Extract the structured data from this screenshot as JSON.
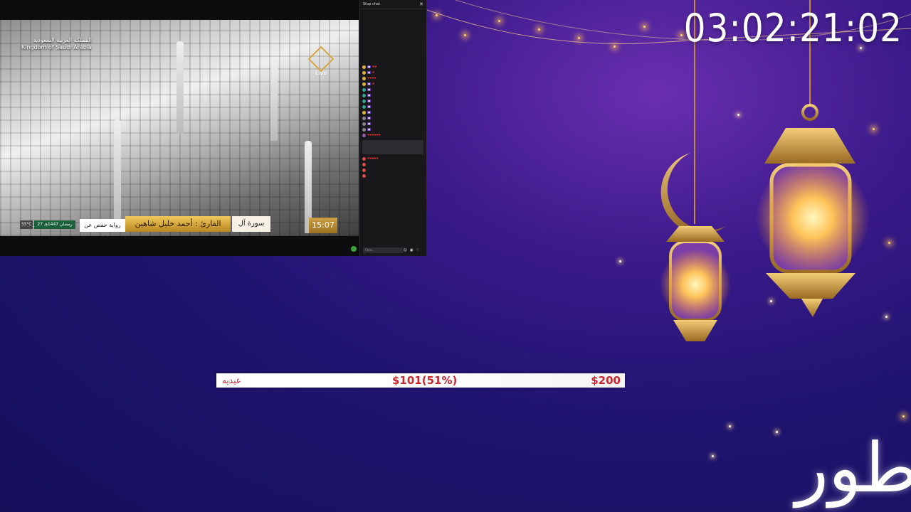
{
  "countdown": "03:02:21:02",
  "stream": {
    "country_ar": "المملكة العربية السعودية",
    "country_en": "Kingdom of Saudi Arabia",
    "channel_status": "Live",
    "reciter": "القارئ : أحمد خليل شاهين",
    "surah": "سورة آل عمران",
    "narration": "رواية حفص عن عاصم",
    "clock": "15:07",
    "temperature": "33°C",
    "date": "27 رمضان 1447هـ"
  },
  "chat": {
    "title": "Stop chat",
    "input_placeholder": "Chat..."
  },
  "goal": {
    "label": "عيديه",
    "current": "$101(51%)",
    "target": "$200",
    "progress_fraction": 0.51
  },
  "decor_text": "طور"
}
